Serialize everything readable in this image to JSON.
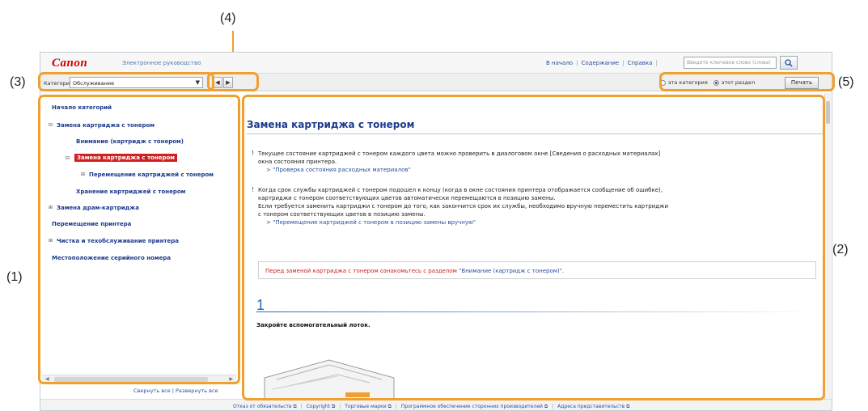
{
  "callouts": {
    "c1": "(1)",
    "c2": "(2)",
    "c3": "(3)",
    "c4": "(4)",
    "c5": "(5)"
  },
  "header": {
    "logo": "Canon",
    "manual_title": "Электронное руководство",
    "nav": [
      "В начало",
      "Содержание",
      "Справка"
    ],
    "search_placeholder": "Введите ключевое слово (слова)",
    "search_icon": "magnifier-icon"
  },
  "toolbar": {
    "category_label": "Категория",
    "category_value": "Обслуживание",
    "prev_icon": "◀",
    "next_icon": "▶",
    "radio_this_category": "эта категория",
    "radio_this_section": "этот раздел",
    "selected_scope": "этот раздел",
    "print_label": "Печать"
  },
  "sidebar": {
    "items": [
      {
        "label": "Начало категорий",
        "box": ""
      },
      {
        "label": "Замена картриджа с тонером",
        "box": "⊟"
      },
      {
        "label": "Внимание (картридж с тонером)",
        "box": ""
      },
      {
        "label": "Замена картриджа с тонером",
        "box": "⊟",
        "selected": true
      },
      {
        "label": "Перемещение картриджей с тонером",
        "box": "⊞"
      },
      {
        "label": "Хранение картриджей с тонером",
        "box": ""
      },
      {
        "label": "Замена драм-картриджа",
        "box": "⊞"
      },
      {
        "label": "Перемещение принтера",
        "box": ""
      },
      {
        "label": "Чистка и техобслуживание принтера",
        "box": "⊞"
      },
      {
        "label": "Местоположение серийного номера",
        "box": ""
      }
    ],
    "collapse_all": "Свернуть все",
    "expand_all": "Развернуть все"
  },
  "content": {
    "title": "Замена картриджа с тонером",
    "para1_line1": "Текущее состояние картриджей с тонером каждого цвета можно проверить в диалоговом окне [Сведения о расходных материалах]",
    "para1_line2": "окна состояния принтера.",
    "link1": "\"Проверка состояния расходных материалов\"",
    "para2_line1": "Когда срок службы картриджей с тонером подошел к концу (когда в окне состояния принтера отображается сообщение об ошибке),",
    "para2_line2": "картриджи с тонером соответствующих цветов автоматически перемещаются в позицию замены.",
    "para2_line3": "Если требуется заменить картриджи с тонером до того, как закончится срок их службы, необходимо вручную переместить картриджи",
    "para2_line4": "с тонером соответствующих цветов в позицию замены.",
    "link2": "\"Перемещение картриджей с тонером в позицию замены вручную\"",
    "note_text": "Перед заменой картриджа с тонером ознакомьтесь с разделом ",
    "note_link": "\"Внимание (картридж с тонером)\"",
    "note_end": ".",
    "step_number": "1",
    "step_text": "Закройте вспомогательный лоток."
  },
  "footer": {
    "links": [
      "Отказ от обязательств",
      "Copyright",
      "Торговые марки",
      "Программное обеспечение сторонних производителей",
      "Адреса представительств"
    ]
  },
  "colors": {
    "brand": "#cc0000",
    "link": "#2a4fa0",
    "highlight": "#f0a030",
    "selected_bg": "#d02020"
  }
}
